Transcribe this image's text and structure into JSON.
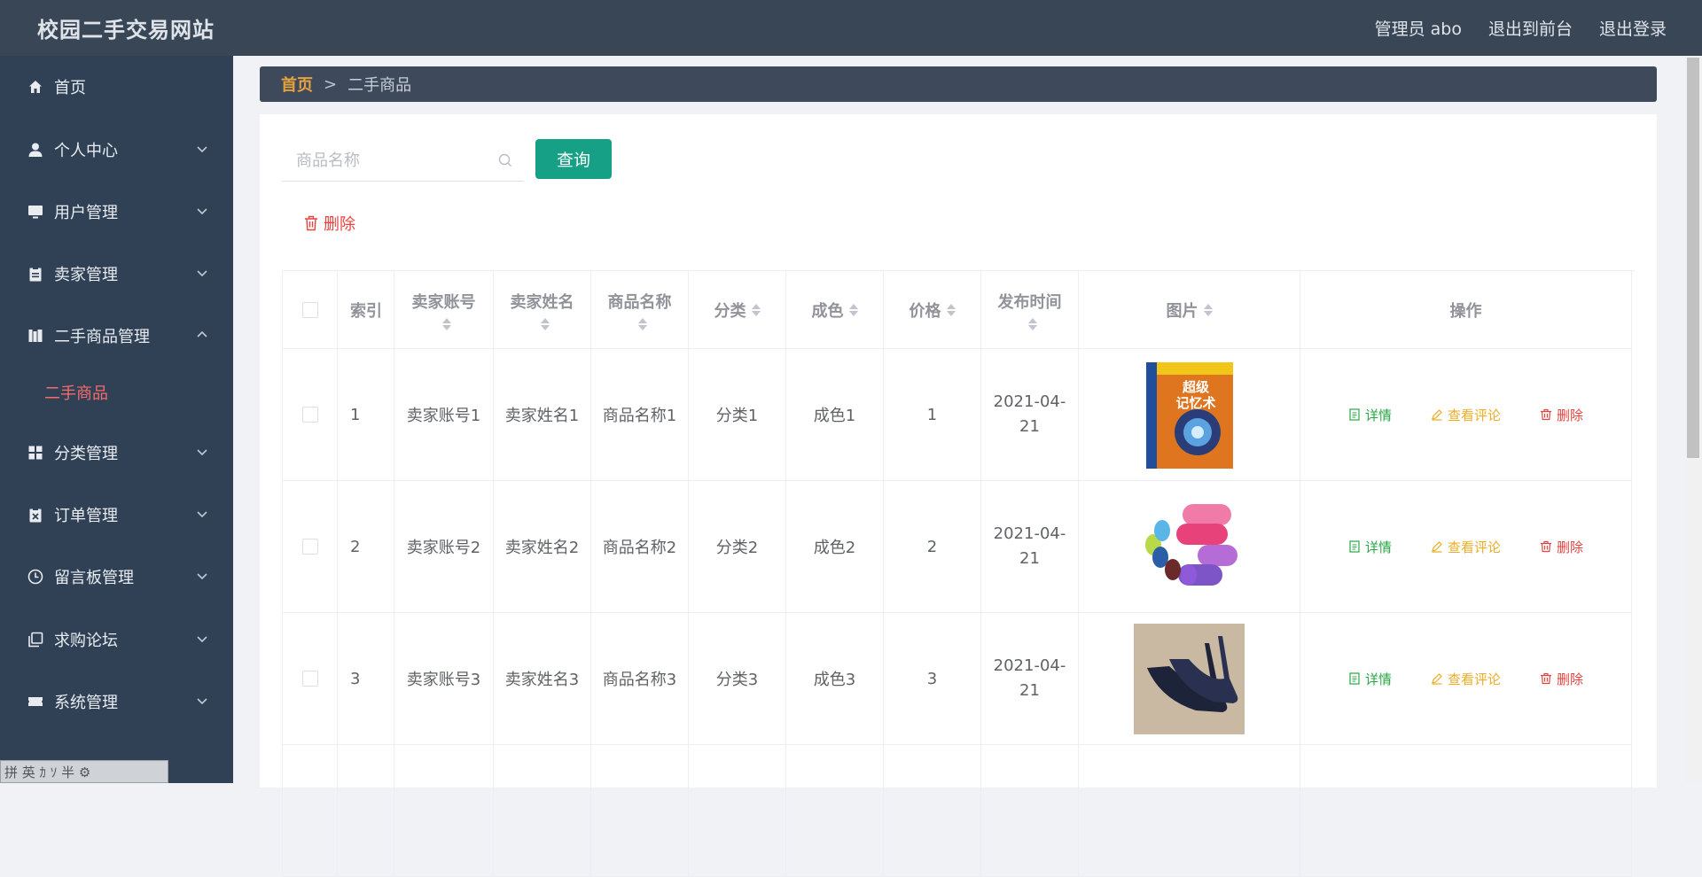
{
  "header": {
    "title": "校园二手交易网站",
    "admin_label": "管理员 abo",
    "front_link": "退出到前台",
    "logout_link": "退出登录"
  },
  "sidebar": {
    "items": [
      {
        "label": "首页",
        "icon": "home-icon"
      },
      {
        "label": "个人中心",
        "icon": "user-icon"
      },
      {
        "label": "用户管理",
        "icon": "monitor-icon"
      },
      {
        "label": "卖家管理",
        "icon": "clipboard-icon"
      },
      {
        "label": "二手商品管理",
        "icon": "books-icon"
      },
      {
        "label": "分类管理",
        "icon": "grid-icon"
      },
      {
        "label": "订单管理",
        "icon": "order-icon"
      },
      {
        "label": "留言板管理",
        "icon": "clock-icon"
      },
      {
        "label": "求购论坛",
        "icon": "copy-icon"
      },
      {
        "label": "系统管理",
        "icon": "ticket-icon"
      }
    ],
    "active_sub": "二手商品"
  },
  "ime": {
    "text": "拼 英 ｶ ｿ 半 ⚙"
  },
  "breadcrumb": {
    "home": "首页",
    "sep": ">",
    "current": "二手商品"
  },
  "search": {
    "placeholder": "商品名称",
    "button": "查询"
  },
  "toolbar": {
    "delete": "删除"
  },
  "table": {
    "headers": {
      "index": "索引",
      "seller_account": "卖家账号",
      "seller_name": "卖家姓名",
      "product_name": "商品名称",
      "category": "分类",
      "condition": "成色",
      "price": "价格",
      "publish_time": "发布时间",
      "image": "图片",
      "actions": "操作"
    },
    "rows": [
      {
        "index": "1",
        "seller_account": "卖家账号1",
        "seller_name": "卖家姓名1",
        "product_name": "商品名称1",
        "category": "分类1",
        "condition": "成色1",
        "price": "1",
        "date_a": "2021-04-",
        "date_b": "21",
        "book_text": "超级记忆术"
      },
      {
        "index": "2",
        "seller_account": "卖家账号2",
        "seller_name": "卖家姓名2",
        "product_name": "商品名称2",
        "category": "分类2",
        "condition": "成色2",
        "price": "2",
        "date_a": "2021-04-",
        "date_b": "21"
      },
      {
        "index": "3",
        "seller_account": "卖家账号3",
        "seller_name": "卖家姓名3",
        "product_name": "商品名称3",
        "category": "分类3",
        "condition": "成色3",
        "price": "3",
        "date_a": "2021-04-",
        "date_b": "21"
      }
    ],
    "action_labels": {
      "detail": "详情",
      "comment": "查看评论",
      "remove": "删除"
    }
  },
  "colors": {
    "header_bg": "#394656",
    "sidebar_bg": "#304156",
    "active_sub": "#f56c6c",
    "query_btn": "#16a085",
    "detail": "#27a844",
    "comment": "#f0ad24",
    "remove": "#e64340",
    "breadcrumb_home": "#e6a23c"
  }
}
